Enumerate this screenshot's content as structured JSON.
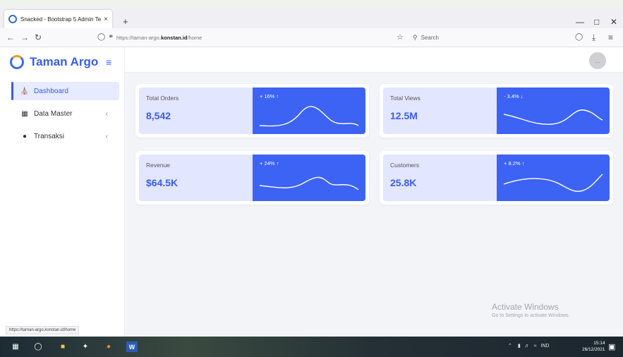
{
  "browser": {
    "tab_title": "Snacked - Bootstrap 5 Admin Te",
    "tab_close": "×",
    "new_tab": "+",
    "url_prefix": "https://taman-argo.",
    "url_domain": "konstan.id",
    "url_path": "/home",
    "search_placeholder": "Search",
    "status_url": "https://taman-argo.konstan.id/home"
  },
  "app": {
    "brand": "Taman Argo",
    "menu": [
      {
        "label": "Dashboard",
        "icon": "home-icon",
        "active": true
      },
      {
        "label": "Data Master",
        "icon": "grid-icon",
        "chevron": "‹"
      },
      {
        "label": "Transaksi",
        "icon": "drop-icon",
        "chevron": "‹"
      }
    ]
  },
  "cards": [
    {
      "label": "Total Orders",
      "value": "8,542",
      "trend": "+ 16% ↑"
    },
    {
      "label": "Total Views",
      "value": "12.5M",
      "trend": "- 3.4% ↓"
    },
    {
      "label": "Revenue",
      "value": "$64.5K",
      "trend": "+ 24% ↑"
    },
    {
      "label": "Customers",
      "value": "25.8K",
      "trend": "+ 8.2% ↑"
    }
  ],
  "watermark": {
    "line1": "Activate Windows",
    "line2": "Go to Settings to activate Windows."
  },
  "taskbar": {
    "lang": "IND",
    "time": "15:14",
    "date": "26/12/2021"
  },
  "colors": {
    "accent": "#3a5cf0",
    "card_blue": "#3d63f5",
    "card_light": "#e3e6ff"
  }
}
